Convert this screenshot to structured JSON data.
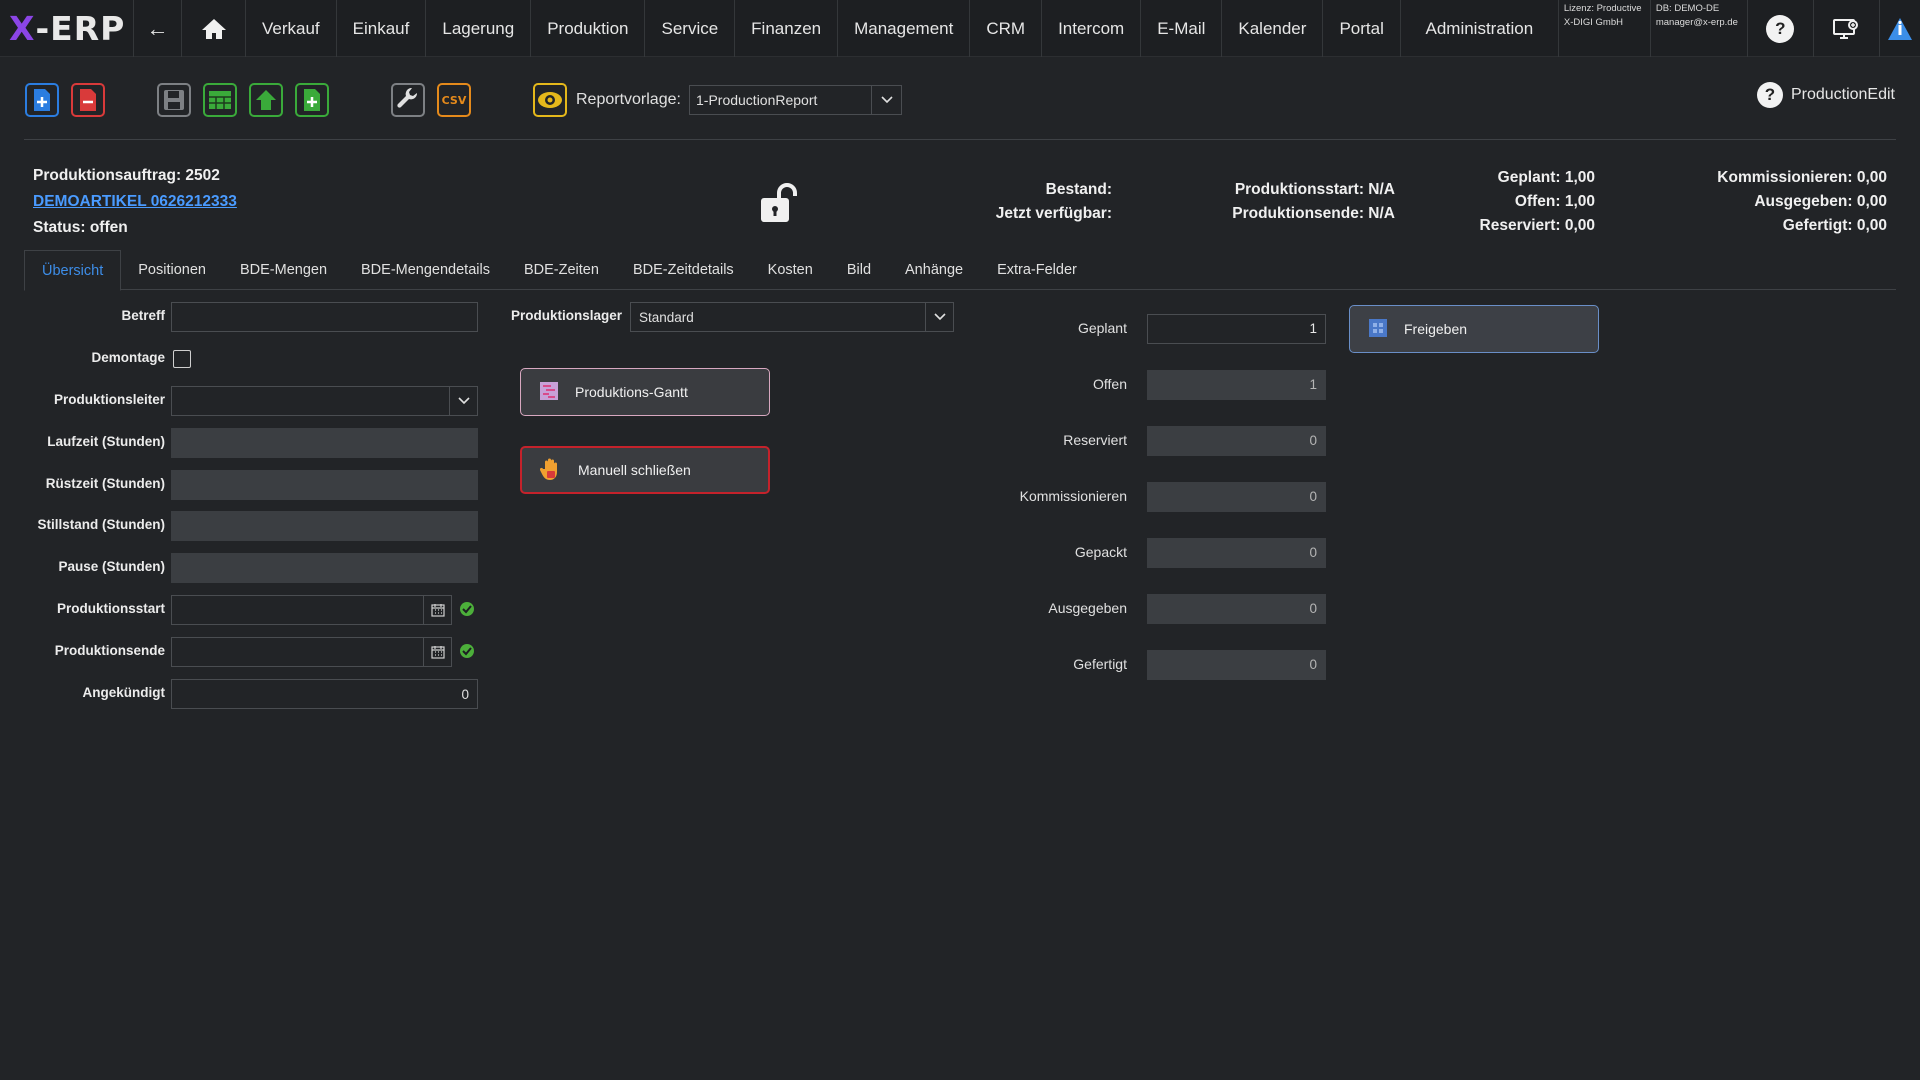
{
  "app": {
    "logo_x": "X",
    "logo_rest": "-ERP"
  },
  "nav": {
    "back_icon": "←",
    "items": [
      "Verkauf",
      "Einkauf",
      "Lagerung",
      "Produktion",
      "Service",
      "Finanzen",
      "Management",
      "CRM",
      "Intercom",
      "E-Mail",
      "Kalender",
      "Portal",
      "Administration"
    ],
    "license_line1": "Lizenz: Productive",
    "license_line2": "X-DIGI GmbH",
    "db_line1": "DB: DEMO-DE",
    "db_line2": "manager@x-erp.de"
  },
  "toolbar": {
    "report_label": "Reportvorlage:",
    "report_value": "1-ProductionReport",
    "help_label": "ProductionEdit",
    "csv_label": "CSV"
  },
  "header": {
    "order": "Produktionsauftrag: 2502",
    "article_link": "DEMOARTIKEL 0626212333",
    "status": "Status: offen",
    "bestand": "Bestand:",
    "verfuegbar": "Jetzt verfügbar:",
    "prod_start": "Produktionsstart: N/A",
    "prod_end": "Produktionsende: N/A",
    "geplant": "Geplant: 1,00",
    "offen": "Offen: 1,00",
    "reserviert": "Reserviert: 0,00",
    "kommissionieren": "Kommissionieren: 0,00",
    "ausgegeben": "Ausgegeben: 0,00",
    "gefertigt": "Gefertigt: 0,00"
  },
  "tabs": [
    "Übersicht",
    "Positionen",
    "BDE-Mengen",
    "BDE-Mengendetails",
    "BDE-Zeiten",
    "BDE-Zeitdetails",
    "Kosten",
    "Bild",
    "Anhänge",
    "Extra-Felder"
  ],
  "form": {
    "betreff": "Betreff",
    "demontage": "Demontage",
    "produktionsleiter": "Produktionsleiter",
    "laufzeit": "Laufzeit (Stunden)",
    "ruestzeit": "Rüstzeit (Stunden)",
    "stillstand": "Stillstand (Stunden)",
    "pause": "Pause (Stunden)",
    "produktionsstart": "Produktionsstart",
    "produktionsende": "Produktionsende",
    "angekuendigt": "Angekündigt",
    "angekuendigt_value": "0",
    "lager_label": "Produktionslager",
    "lager_value": "Standard"
  },
  "actions": {
    "gantt": "Produktions-Gantt",
    "close": "Manuell schließen",
    "release": "Freigeben"
  },
  "quantities": [
    {
      "label": "Geplant",
      "value": "1"
    },
    {
      "label": "Offen",
      "value": "1"
    },
    {
      "label": "Reserviert",
      "value": "0"
    },
    {
      "label": "Kommissionieren",
      "value": "0"
    },
    {
      "label": "Gepackt",
      "value": "0"
    },
    {
      "label": "Ausgegeben",
      "value": "0"
    },
    {
      "label": "Gefertigt",
      "value": "0"
    }
  ]
}
